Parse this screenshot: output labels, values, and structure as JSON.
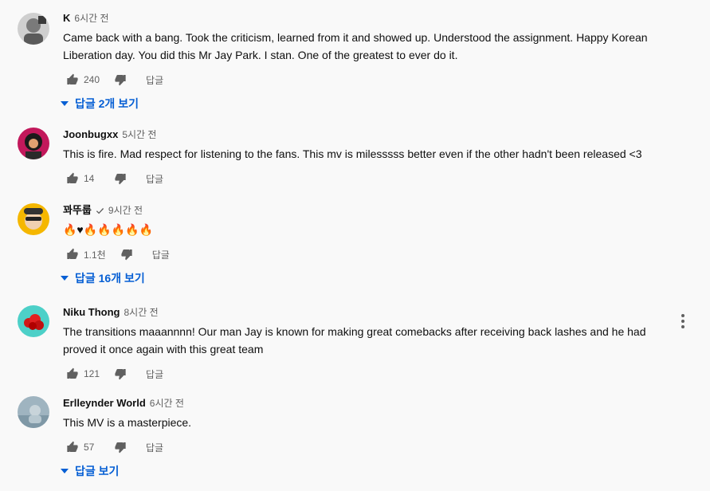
{
  "comments": [
    {
      "author": "K",
      "time": "6시간 전",
      "text": "Came back with a bang. Took the criticism, learned from it and showed up. Understood the assignment. Happy Korean Liberation day. You did this Mr Jay Park. I stan. One of the greatest to ever do it.",
      "likes": "240",
      "reply_label": "답글",
      "replies_label": "답글 2개 보기",
      "avatar_color": "#8e8e8e"
    },
    {
      "author": "Joonbugxx",
      "time": "5시간 전",
      "text": "This is fire. Mad respect for listening to the fans. This mv is milesssss better even if the other hadn't been released <3",
      "likes": "14",
      "reply_label": "답글",
      "avatar_color": "#c2185b"
    },
    {
      "author": "꽈뚜룹",
      "time": "9시간 전",
      "text": "🔥♥🔥🔥🔥🔥🔥",
      "likes": "1.1천",
      "reply_label": "답글",
      "replies_label": "답글 16개 보기",
      "avatar_color": "#f5b700"
    },
    {
      "author": "Niku Thong",
      "time": "8시간 전",
      "text": "The transitions maaannnn! Our man Jay is known for making great comebacks after receiving back lashes and he had proved it once again with this great team",
      "likes": "121",
      "reply_label": "답글",
      "avatar_color": "#4dd0c8"
    },
    {
      "author": "Erlleynder World",
      "time": "6시간 전",
      "text": "This MV is a masterpiece.",
      "likes": "57",
      "reply_label": "답글",
      "replies_label": "답글 보기",
      "avatar_color": "#9fb4c0"
    }
  ],
  "colors": {
    "link": "#065fd4",
    "secondary_text": "#606060",
    "background": "#f9f9f9"
  }
}
